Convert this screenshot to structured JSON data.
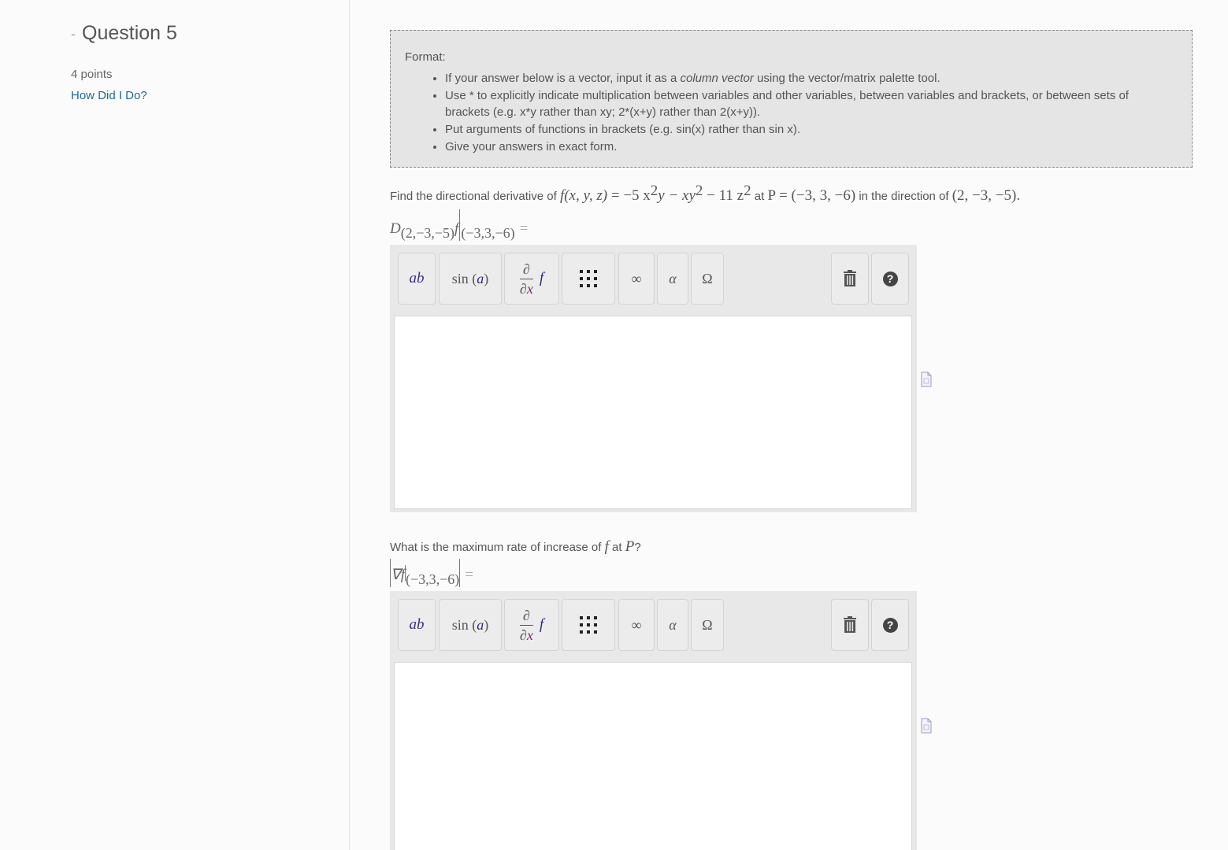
{
  "sidebar": {
    "collapse_symbol": "-",
    "question_title": "Question 5",
    "points": "4 points",
    "how_did_i_do": "How Did I Do?"
  },
  "format": {
    "title": "Format:",
    "items": [
      {
        "before": "If your answer below is a vector, input it as a ",
        "emphasis": "column vector",
        "after": " using the vector/matrix palette tool."
      },
      {
        "text": "Use * to explicitly indicate multiplication between variables and other variables, between variables and brackets, or between sets of brackets (e.g. x*y rather than xy; 2*(x+y) rather than 2(x+y))."
      },
      {
        "text": "Put arguments of functions in brackets (e.g. sin(x) rather than sin x)."
      },
      {
        "text": "Give your answers in exact form."
      }
    ]
  },
  "question1": {
    "prefix": "Find the directional derivative of ",
    "function_lhs": "f(x, y, z)",
    "equals": " = −5 x",
    "exp_a": "2",
    "term_b": "y − xy",
    "exp_b": "2",
    "term_c": " − 11 z",
    "exp_c": "2",
    "at": " at ",
    "point": "P = (−3, 3, −6)",
    "in_direction": " in the direction of ",
    "direction": "(2, −3, −5)."
  },
  "label1": {
    "d": "D",
    "sub": "(2,−3,−5)",
    "f": "f",
    "eval_sub": "(−3,3,−6)",
    "eq": "="
  },
  "question2": {
    "prefix": "What is the maximum rate of increase of ",
    "f": "f",
    "at": " at ",
    "p": "P",
    "suffix": "?"
  },
  "label2": {
    "nabla_f": "∇f",
    "eval_sub": "(−3,3,−6)",
    "eq": "="
  },
  "toolbar": {
    "power_base": "a",
    "power_exp": "b",
    "sin_name": "sin",
    "sin_arg": "a",
    "partial_num": "∂",
    "partial_den_d": "∂",
    "partial_den_x": "x",
    "partial_f": "f",
    "infinity": "∞",
    "alpha": "α",
    "omega": "Ω",
    "help": "?",
    "matrix_icon": "matrix-grid-icon",
    "delete_icon": "trash-icon"
  },
  "answers": {
    "answer1_value": "",
    "answer2_value": ""
  }
}
